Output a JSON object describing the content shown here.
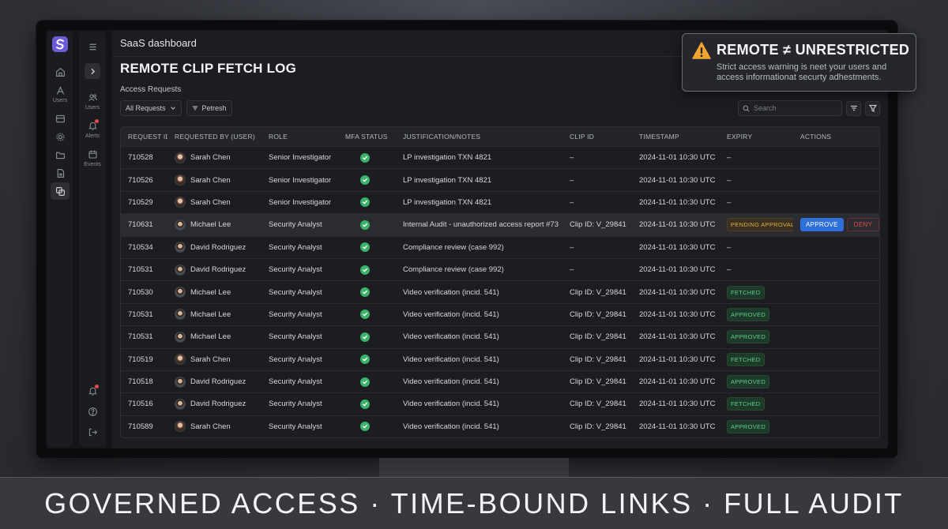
{
  "app": {
    "title": "SaaS dashboard",
    "page_title": "REMOTE CLIP FETCH LOG",
    "section": "Access Requests"
  },
  "rail": {
    "items": [
      {
        "icon": "home-icon",
        "label": ""
      },
      {
        "icon": "users-icon",
        "label": "Users"
      },
      {
        "icon": "inbox-icon",
        "label": ""
      },
      {
        "icon": "gear-icon",
        "label": ""
      },
      {
        "icon": "folder-icon",
        "label": ""
      },
      {
        "icon": "document-icon",
        "label": ""
      },
      {
        "icon": "clip-icon",
        "label": ""
      }
    ],
    "sub_items": [
      {
        "icon": "users-icon",
        "label": "Users"
      },
      {
        "icon": "bell-icon",
        "label": "Alerts"
      },
      {
        "icon": "calendar-icon",
        "label": "Events"
      }
    ]
  },
  "filters": {
    "all_requests": "All Requests",
    "refresh": "Petresh",
    "search_placeholder": "Search"
  },
  "table": {
    "columns": [
      "REQUEST ID",
      "REQUESTED BY (USER)",
      "ROLE",
      "MFA STATUS",
      "JUSTIFICATION/NOTES",
      "CLIP ID",
      "TIMESTAMP",
      "EXPIRY",
      "ACTIONS"
    ],
    "rows": [
      {
        "id": "710528",
        "user": "Sarah Chen",
        "gender": "f",
        "role": "Senior Investigator",
        "notes": "LP investigation TXN 4821",
        "clip": "–",
        "ts": "2024-11-01 10:30 UTC",
        "expiry": "–",
        "status": "",
        "actions": false
      },
      {
        "id": "710526",
        "user": "Sarah Chen",
        "gender": "f",
        "role": "Senior Investigator",
        "notes": "LP investigation TXN 4821",
        "clip": "–",
        "ts": "2024-11-01 10:30 UTC",
        "expiry": "–",
        "status": "",
        "actions": false
      },
      {
        "id": "710529",
        "user": "Sarah Chen",
        "gender": "f",
        "role": "Senior Investigator",
        "notes": "LP investigation TXN 4821",
        "clip": "–",
        "ts": "2024-11-01 10:30 UTC",
        "expiry": "–",
        "status": "",
        "actions": false
      },
      {
        "id": "710631",
        "user": "Michael Lee",
        "gender": "m",
        "role": "Security Analyst",
        "notes": "Internal Audit - unauthorized access report #73",
        "clip": "Clip ID: V_29841",
        "ts": "2024-11-01 10:30 UTC",
        "expiry": "",
        "status": "PENDING APPROVAL",
        "actions": true
      },
      {
        "id": "710534",
        "user": "David Rodriguez",
        "gender": "m",
        "role": "Security Analyst",
        "notes": "Compliance review (case 992)",
        "clip": "–",
        "ts": "2024-11-01 10:30 UTC",
        "expiry": "–",
        "status": "",
        "actions": false
      },
      {
        "id": "710531",
        "user": "David Rodriguez",
        "gender": "m",
        "role": "Security Analyst",
        "notes": "Compliance review (case 992)",
        "clip": "–",
        "ts": "2024-11-01 10:30 UTC",
        "expiry": "–",
        "status": "",
        "actions": false
      },
      {
        "id": "710530",
        "user": "Michael Lee",
        "gender": "m",
        "role": "Security Analyst",
        "notes": "Video verification (incid. 541)",
        "clip": "Clip ID: V_29841",
        "ts": "2024-11-01 10:30 UTC",
        "expiry": "",
        "status": "FETCHED",
        "actions": false
      },
      {
        "id": "710531",
        "user": "Michael Lee",
        "gender": "m",
        "role": "Security Analyst",
        "notes": "Video verification (incid. 541)",
        "clip": "Clip ID: V_29841",
        "ts": "2024-11-01 10:30 UTC",
        "expiry": "",
        "status": "APPROVED",
        "actions": false
      },
      {
        "id": "710531",
        "user": "Michael Lee",
        "gender": "m",
        "role": "Security Analyst",
        "notes": "Video verification (incid. 541)",
        "clip": "Clip ID: V_29841",
        "ts": "2024-11-01 10:30 UTC",
        "expiry": "",
        "status": "APPROVED",
        "actions": false
      },
      {
        "id": "710519",
        "user": "Sarah Chen",
        "gender": "f",
        "role": "Security Analyst",
        "notes": "Video verification (incid. 541)",
        "clip": "Clip ID: V_29841",
        "ts": "2024-11-01 10:30 UTC",
        "expiry": "",
        "status": "FETCHED",
        "actions": false
      },
      {
        "id": "710518",
        "user": "David Rodriguez",
        "gender": "m",
        "role": "Security Analyst",
        "notes": "Video verification (incid. 541)",
        "clip": "Clip ID: V_29841",
        "ts": "2024-11-01 10:30 UTC",
        "expiry": "",
        "status": "APPROVED",
        "actions": false
      },
      {
        "id": "710516",
        "user": "David Rodriguez",
        "gender": "m",
        "role": "Security Analyst",
        "notes": "Video verification (incid. 541)",
        "clip": "Clip ID: V_29841",
        "ts": "2024-11-01 10:30 UTC",
        "expiry": "",
        "status": "FETCHED",
        "actions": false
      },
      {
        "id": "710589",
        "user": "Sarah Chen",
        "gender": "f",
        "role": "Security Analyst",
        "notes": "Video verification (incid. 541)",
        "clip": "Clip ID: V_29841",
        "ts": "2024-11-01 10:30 UTC",
        "expiry": "",
        "status": "APPROVED",
        "actions": false
      }
    ],
    "approve_label": "APPROVE",
    "deny_label": "DENY"
  },
  "warning": {
    "title": "REMOTE ≠ UNRESTRICTED",
    "body": "Strict access warning is neet your users and access informationat securty adhestments."
  },
  "banner": {
    "text": "GOVERNED ACCESS · TIME-BOUND LINKS · FULL AUDIT"
  },
  "colors": {
    "accent": "#2f6fdc",
    "success": "#3bb26a",
    "pending": "#e0b04a",
    "danger": "#e5484d"
  }
}
